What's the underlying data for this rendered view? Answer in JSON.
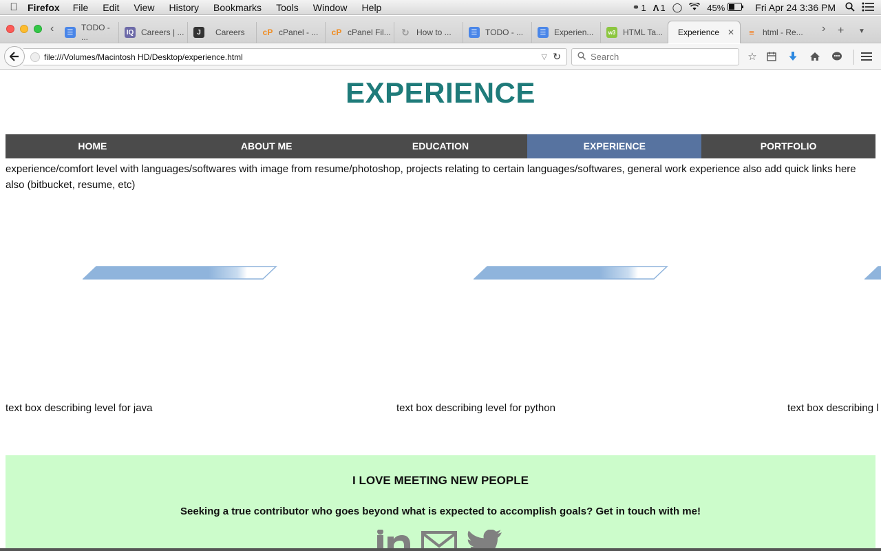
{
  "menubar": {
    "app": "Firefox",
    "items": [
      "File",
      "Edit",
      "View",
      "History",
      "Bookmarks",
      "Tools",
      "Window",
      "Help"
    ],
    "status": {
      "cc_count": "1",
      "adobe_count": "1",
      "battery": "45%",
      "clock": "Fri Apr 24  3:36 PM"
    }
  },
  "tabs": [
    {
      "label": "TODO - ...",
      "icon": "docs-icon",
      "color": "#4a86e8"
    },
    {
      "label": "Careers | ...",
      "icon": "iq-icon",
      "color": "#6d6aa8"
    },
    {
      "label": "Careers",
      "icon": "page-icon",
      "color": "#333333"
    },
    {
      "label": "cPanel - ...",
      "icon": "cpanel-icon",
      "color": "#ef8c22"
    },
    {
      "label": "cPanel Fil...",
      "icon": "cpanel-icon",
      "color": "#ef8c22"
    },
    {
      "label": "How to ...",
      "icon": "loading-icon",
      "color": "#999999"
    },
    {
      "label": "TODO - ...",
      "icon": "docs-icon",
      "color": "#4a86e8"
    },
    {
      "label": "Experien...",
      "icon": "docs-icon",
      "color": "#4a86e8"
    },
    {
      "label": "HTML Ta...",
      "icon": "w3-icon",
      "color": "#8cc63f"
    },
    {
      "label": "Experience",
      "icon": "none",
      "active": true
    },
    {
      "label": "html - Re...",
      "icon": "stackoverflow-icon",
      "color": "#f48024"
    }
  ],
  "address": {
    "url": "file:///Volumes/Macintosh HD/Desktop/experience.html",
    "search_placeholder": "Search"
  },
  "page": {
    "title": "EXPERIENCE",
    "nav": [
      "HOME",
      "ABOUT ME",
      "EDUCATION",
      "EXPERIENCE",
      "PORTFOLIO"
    ],
    "active_nav": "EXPERIENCE",
    "intro": "experience/comfort level with languages/softwares with image from resume/photoshop, projects relating to certain languages/softwares, general work experience also add quick links here also (bitbucket, resume, etc)",
    "skills": [
      {
        "language": "java",
        "caption": "text box describing level for java",
        "level": 0.85
      },
      {
        "language": "python",
        "caption": "text box describing level for python",
        "level": 0.85
      },
      {
        "language": "",
        "caption": "text box describing l",
        "level": 0.85
      }
    ],
    "contact": {
      "title": "I LOVE MEETING NEW PEOPLE",
      "subtitle": "Seeking a true contributor who goes beyond what is expected to accomplish goals? Get in touch with me!",
      "icons": [
        "linkedin-icon",
        "email-icon",
        "twitter-icon"
      ]
    }
  },
  "colors": {
    "title_teal": "#1f7b7a",
    "nav_dark": "#4b4b4b",
    "nav_active": "#5773a0",
    "skill_bar": "#8fb4dc",
    "contact_bg": "#ccfccb"
  }
}
